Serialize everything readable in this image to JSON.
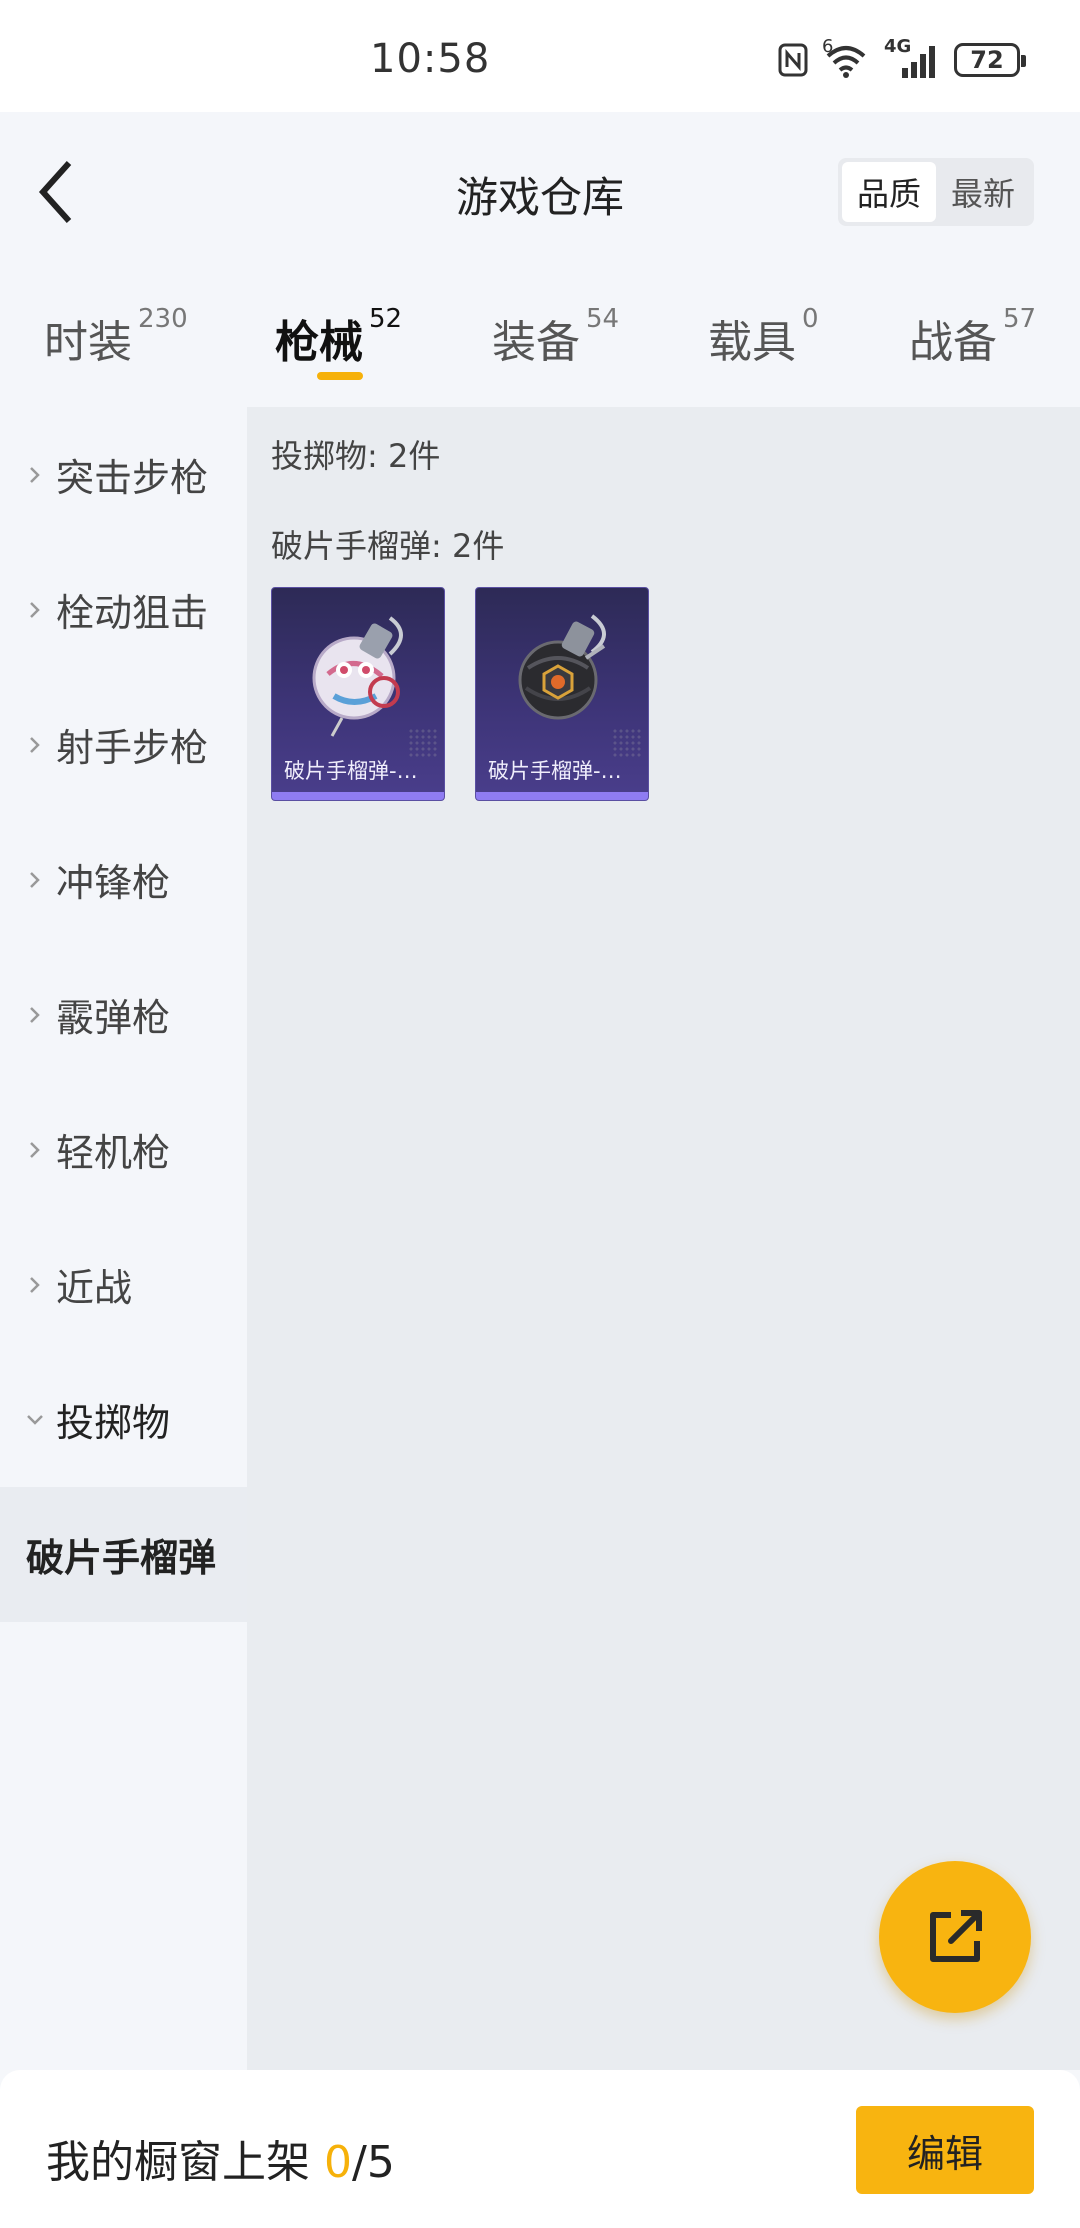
{
  "status_bar": {
    "time": "10:58",
    "network": "4G",
    "wifi_badge": "6",
    "battery": "72"
  },
  "header": {
    "title": "游戏仓库",
    "back_icon": "chevron-left-icon",
    "sort": {
      "options": [
        "品质",
        "最新"
      ],
      "selected": "品质"
    }
  },
  "tabs": [
    {
      "label": "时装",
      "count": "230"
    },
    {
      "label": "枪械",
      "count": "52"
    },
    {
      "label": "装备",
      "count": "54"
    },
    {
      "label": "载具",
      "count": "0"
    },
    {
      "label": "战备",
      "count": "57"
    }
  ],
  "active_tab": "枪械",
  "sidebar": {
    "items": [
      {
        "label": "突击步枪"
      },
      {
        "label": "栓动狙击"
      },
      {
        "label": "射手步枪"
      },
      {
        "label": "冲锋枪"
      },
      {
        "label": "霰弹枪"
      },
      {
        "label": "轻机枪"
      },
      {
        "label": "近战"
      },
      {
        "label": "投掷物"
      }
    ],
    "expanded": "投掷物",
    "sub_selected": "破片手榴弹"
  },
  "content": {
    "category_summary": "投掷物: 2件",
    "group_title": "破片手榴弹: 2件",
    "items": [
      {
        "name": "破片手榴弹-…",
        "icon": "grenade-pink-icon"
      },
      {
        "name": "破片手榴弹-…",
        "icon": "grenade-black-icon"
      }
    ]
  },
  "fab": {
    "icon": "share-external-icon"
  },
  "bottom_bar": {
    "label": "我的橱窗上架",
    "current": "0",
    "separator": "/",
    "total": "5",
    "edit_label": "编辑"
  },
  "colors": {
    "accent": "#f6b10a",
    "card_bg": "#3d3477",
    "card_bar": "#8f7cf2"
  }
}
